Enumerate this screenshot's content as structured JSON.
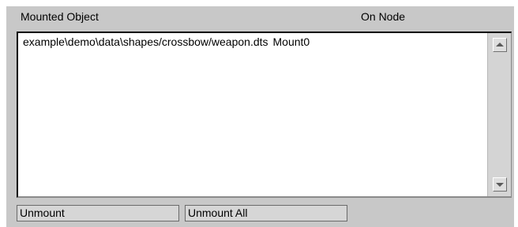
{
  "headers": {
    "mounted_object": "Mounted Object",
    "on_node": "On Node"
  },
  "rows": [
    {
      "object": "example\\demo\\data\\shapes/crossbow/weapon.dts",
      "node": "Mount0"
    }
  ],
  "buttons": {
    "unmount": "Unmount",
    "unmount_all": "Unmount All"
  },
  "icons": {
    "scroll_up": "arrow-up-icon",
    "scroll_down": "arrow-down-icon"
  }
}
